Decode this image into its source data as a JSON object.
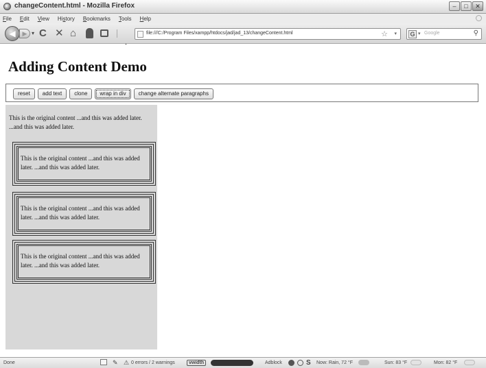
{
  "window": {
    "title": "changeContent.html - Mozilla Firefox",
    "controls": {
      "minimize": "–",
      "maximize": "□",
      "close": "✕"
    }
  },
  "menu": {
    "items": [
      {
        "label": "File",
        "underline": "F",
        "rest": "ile"
      },
      {
        "label": "Edit",
        "underline": "E",
        "rest": "dit"
      },
      {
        "label": "View",
        "underline": "V",
        "rest": "iew"
      },
      {
        "label": "History",
        "underline": "s",
        "pre": "Hi",
        "rest": "tory"
      },
      {
        "label": "Bookmarks",
        "underline": "B",
        "rest": "ookmarks"
      },
      {
        "label": "Tools",
        "underline": "T",
        "rest": "ools"
      },
      {
        "label": "Help",
        "underline": "H",
        "rest": "elp"
      }
    ]
  },
  "toolbar": {
    "back_glyph": "◀",
    "forward_glyph": "▶",
    "dropdown_glyph": "▾",
    "reload_glyph": "C",
    "stop_glyph": "✕",
    "home_glyph": "⌂",
    "url": "file:///C:/Program Files/xampp/htdocs/jad/jad_13/changeContent.html",
    "bookmark_star": "☆",
    "search_engine_letter": "G",
    "search_placeholder": "Google",
    "search_glyph": "⚲"
  },
  "page": {
    "heading": "Adding Content Demo",
    "buttons": [
      {
        "id": "reset",
        "label": "reset"
      },
      {
        "id": "add-text",
        "label": "add text"
      },
      {
        "id": "clone",
        "label": "clone"
      },
      {
        "id": "wrap-in-div",
        "label": "wrap in div",
        "focused": true
      },
      {
        "id": "change-alternate-paragraphs",
        "label": "change alternate paragraphs"
      }
    ],
    "original_paragraph": "This is the original content ...and this was added later. ...and this was added later.",
    "wrapped_paragraphs": [
      "This is the original content ...and this was added later. ...and this was added later.",
      "This is the original content ...and this was added later. ...and this was added later.",
      "This is the original content ...and this was added later. ...and this was added later."
    ]
  },
  "status": {
    "left": "Done",
    "errors": "0 errors / 2 warnings",
    "vwidth": "vwidth",
    "adblock": "Adblock",
    "letter_s": "S",
    "weather_now": "Now: Rain, 72 °F",
    "weather_sun": "Sun: 83 °F",
    "weather_mon": "Mon: 82 °F"
  }
}
